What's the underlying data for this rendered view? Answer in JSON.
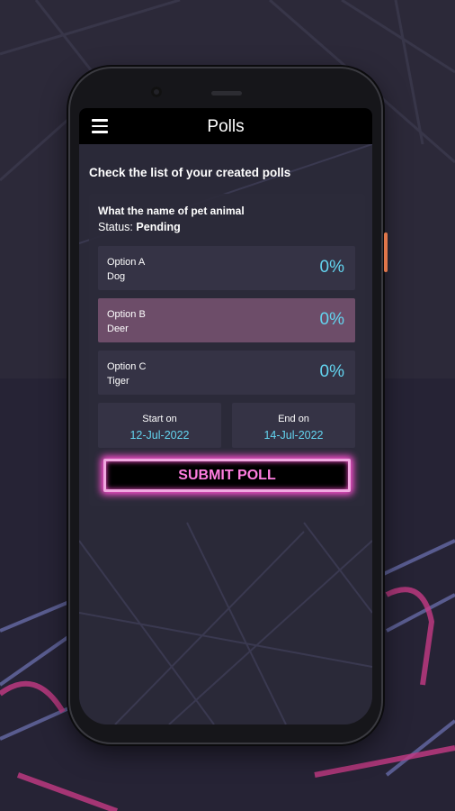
{
  "appbar": {
    "title": "Polls"
  },
  "page": {
    "subtitle": "Check the list of your created polls"
  },
  "poll": {
    "question": "What the name of pet animal",
    "status_label": "Status:",
    "status_value": "Pending",
    "options": [
      {
        "name": "Option A",
        "value": "Dog",
        "percent": "0%"
      },
      {
        "name": "Option B",
        "value": "Deer",
        "percent": "0%"
      },
      {
        "name": "Option C",
        "value": "Tiger",
        "percent": "0%"
      }
    ],
    "start_label": "Start on",
    "start_date": "12-Jul-2022",
    "end_label": "End on",
    "end_date": "14-Jul-2022",
    "submit_label": "SUBMIT POLL"
  },
  "colors": {
    "appbar": "#000000",
    "card": "#2b2a39",
    "option": "#353345",
    "option_selected": "#6d4d69",
    "percent_text": "#63d4ef",
    "submit_glow": "#ff4fd2",
    "submit_text": "#ff7ee0"
  },
  "icons": {
    "menu": "hamburger-menu-icon"
  }
}
